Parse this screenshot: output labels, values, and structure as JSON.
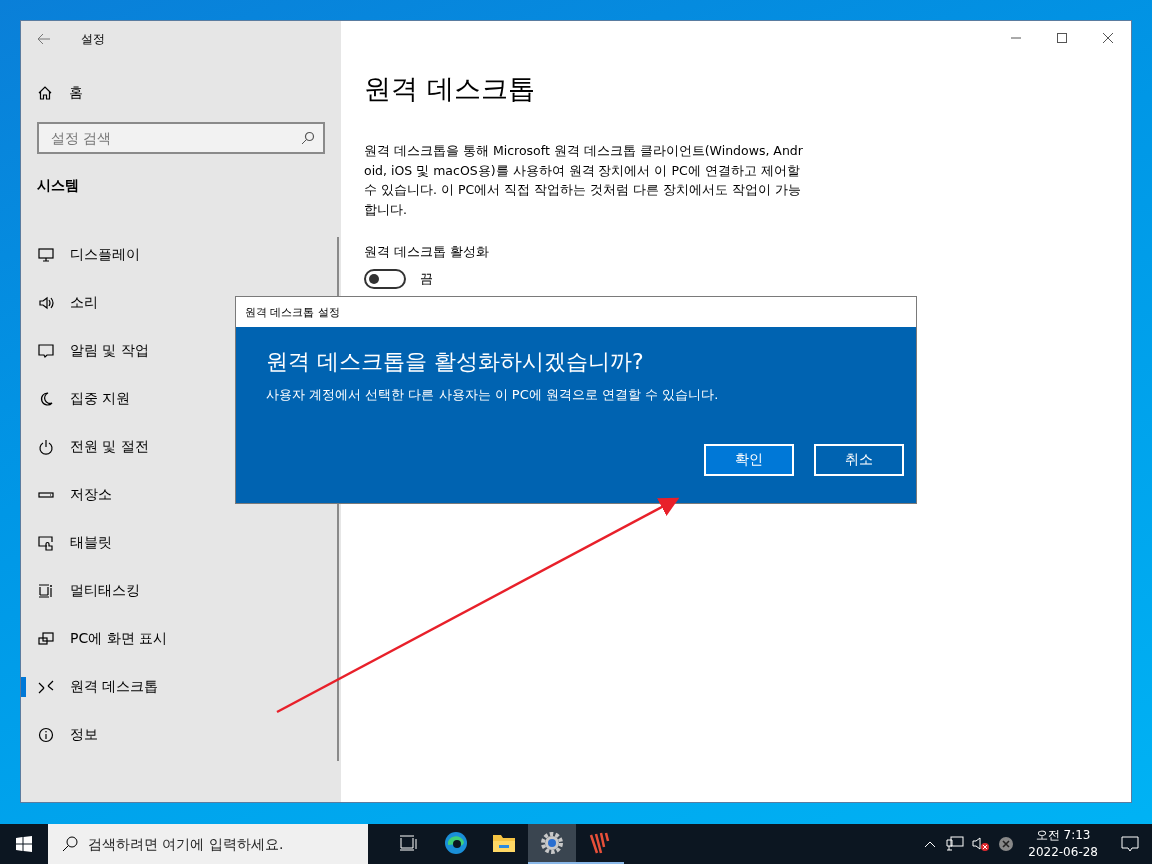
{
  "window": {
    "title": "설정"
  },
  "sidebar": {
    "home": "홈",
    "search": {
      "placeholder": "설정 검색"
    },
    "section": "시스템",
    "items": [
      {
        "label": "디스플레이",
        "kind": "display",
        "selected": false
      },
      {
        "label": "소리",
        "kind": "sound",
        "selected": false
      },
      {
        "label": "알림 및 작업",
        "kind": "notify",
        "selected": false
      },
      {
        "label": "집중 지원",
        "kind": "moon",
        "selected": false
      },
      {
        "label": "전원 및 절전",
        "kind": "power",
        "selected": false
      },
      {
        "label": "저장소",
        "kind": "storage",
        "selected": false
      },
      {
        "label": "태블릿",
        "kind": "tablet",
        "selected": false
      },
      {
        "label": "멀티태스킹",
        "kind": "multitask",
        "selected": false
      },
      {
        "label": "PC에 화면 표시",
        "kind": "project",
        "selected": false
      },
      {
        "label": "원격 데스크톱",
        "kind": "remote",
        "selected": true
      },
      {
        "label": "정보",
        "kind": "info",
        "selected": false
      }
    ]
  },
  "content": {
    "title": "원격 데스크톱",
    "description": "원격 데스크톱을 통해 Microsoft 원격 데스크톱 클라이언트(Windows, Android, iOS 및 macOS용)를 사용하여 원격 장치에서 이 PC에 연결하고 제어할 수 있습니다. 이 PC에서 직접 작업하는 것처럼 다른 장치에서도 작업이 가능합니다.",
    "toggle_label": "원격 데스크톱 활성화",
    "toggle": {
      "on": false,
      "state_text": "끔"
    }
  },
  "dialog": {
    "title": "원격 데스크톱 설정",
    "heading": "원격 데스크톱을 활성화하시겠습니까?",
    "message": "사용자 계정에서 선택한 다른 사용자는 이 PC에 원격으로 연결할 수 있습니다.",
    "buttons": [
      {
        "label": "확인",
        "primary": true
      },
      {
        "label": "취소",
        "primary": false
      }
    ]
  },
  "taskbar": {
    "search": {
      "placeholder": "검색하려면 여기에 입력하세요."
    },
    "apps": [
      {
        "kind": "taskview",
        "selected": false,
        "running": false
      },
      {
        "kind": "edge",
        "selected": false,
        "running": false
      },
      {
        "kind": "explorer",
        "selected": false,
        "running": false
      },
      {
        "kind": "settings",
        "selected": true,
        "running": true
      },
      {
        "kind": "app",
        "selected": false,
        "running": true
      }
    ],
    "time": "오전 7:13",
    "date": "2022-06-28"
  }
}
